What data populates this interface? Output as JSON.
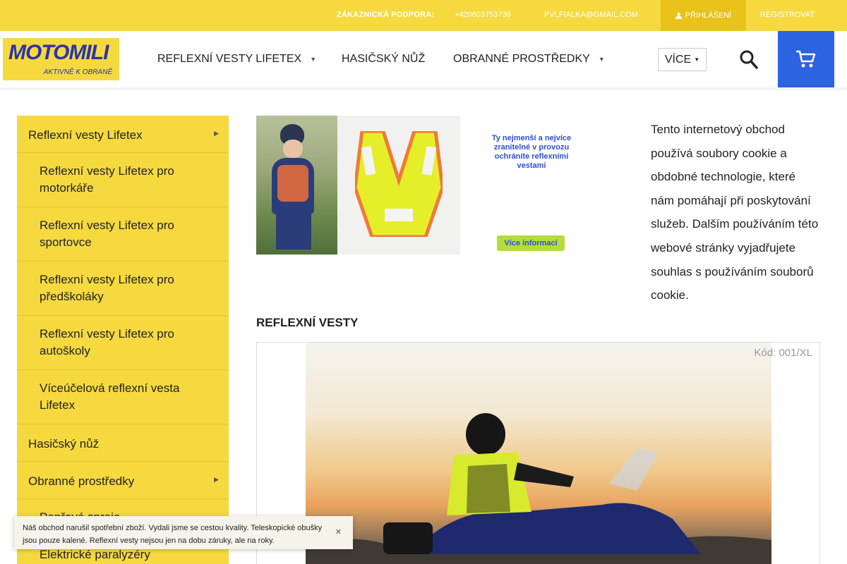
{
  "topbar": {
    "support_label": "ZÁKAZNICKÁ PODPORA:",
    "phone": "+420603753736",
    "email": "PVLFIALKA@GMAIL.COM",
    "login_label": "PŘIHLÁŠENÍ",
    "register_label": "REGISTROVAT"
  },
  "logo": {
    "main": "MOTOMILI",
    "tagline": "AKTIVNĚ K OBRANĚ"
  },
  "nav": {
    "items": [
      {
        "label": "REFLEXNÍ VESTY LIFETEX",
        "has_submenu": true
      },
      {
        "label": "HASIČSKÝ NŮŽ",
        "has_submenu": false
      },
      {
        "label": "OBRANNÉ PROSTŘEDKY",
        "has_submenu": true
      }
    ],
    "more_label": "VÍCE",
    "search_icon": "search-icon",
    "cart_icon": "cart-icon"
  },
  "sidebar": {
    "items": [
      {
        "label": "Reflexní vesty Lifetex",
        "level": 1,
        "expanded": true
      },
      {
        "label": "Reflexní vesty Lifetex pro motorkáře",
        "level": 2
      },
      {
        "label": "Reflexní vesty Lifetex pro sportovce",
        "level": 2
      },
      {
        "label": "Reflexní vesty Lifetex pro předškoláky",
        "level": 2
      },
      {
        "label": "Reflexní vesty Lifetex pro autoškoly",
        "level": 2
      },
      {
        "label": "Víceúčelová reflexní vesta Lifetex",
        "level": 2
      },
      {
        "label": "Hasičský nůž",
        "level": 1,
        "expanded": false
      },
      {
        "label": "Obranné prostředky",
        "level": 1,
        "expanded": true
      },
      {
        "label": "Pepřové spreje",
        "level": 2
      },
      {
        "label": "Elektrické paralyzéry",
        "level": 2
      }
    ]
  },
  "banner": {
    "tagline": "Ty nejmenší a nejvíce zranitelné v provozu ochráníte reflexními vestami",
    "more_button": "Více informací"
  },
  "cookie_notice": "Tento internetový obchod používá soubory cookie a obdobné technologie, které nám pomáhají při poskytování služeb. Dalším používáním této webové stránky vyjadřujete souhlas s používáním souborů cookie.",
  "section": {
    "title": "REFLEXNÍ VESTY"
  },
  "product": {
    "code": "Kód: 001/XL"
  },
  "toast": {
    "message": "Náš obchod narušil spotřební zboží. Vydali jsme se cestou kvality. Teleskopické obušky jsou pouze kalené. Reflexní vesty nejsou jen na dobu záruky, ale na roky.",
    "close_icon": "close-icon"
  },
  "colors": {
    "brand_yellow": "#f5d93f",
    "brand_blue": "#2b63e0",
    "logo_blue": "#2a35a8",
    "banner_green": "#b6dc3c"
  }
}
